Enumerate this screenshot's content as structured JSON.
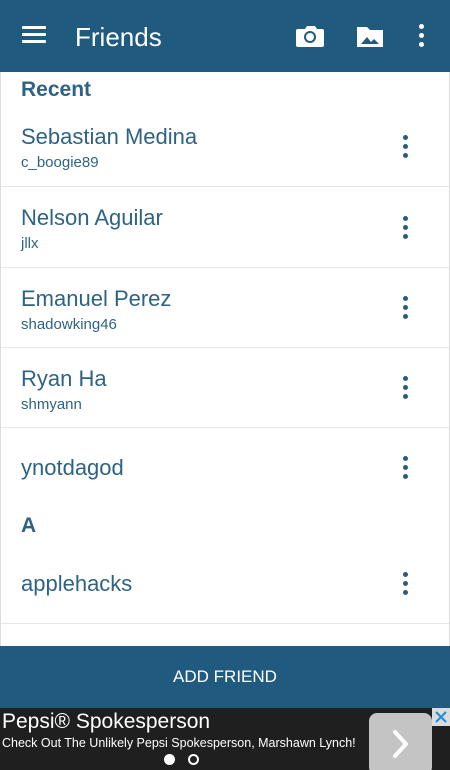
{
  "appbar": {
    "title": "Friends",
    "color": "#215a7f"
  },
  "sections": [
    {
      "header": "Recent"
    },
    {
      "header": "A"
    }
  ],
  "friends": [
    {
      "name": "Sebastian Medina",
      "username": "c_boogie89"
    },
    {
      "name": "Nelson Aguilar",
      "username": "jllx"
    },
    {
      "name": "Emanuel Perez",
      "username": "shadowking46"
    },
    {
      "name": "Ryan Ha",
      "username": "shmyann"
    },
    {
      "name": "ynotdagod",
      "username": ""
    },
    {
      "name": "applehacks",
      "username": ""
    }
  ],
  "footer": {
    "add_friend_label": "ADD FRIEND"
  },
  "ad": {
    "headline": "Pepsi® Spokesperson",
    "subtext": "Check Out The Unlikely Pepsi Spokesperson, Marshawn Lynch!",
    "pages": 2,
    "active_page": 1
  },
  "icons": [
    "menu-icon",
    "camera-icon",
    "image-folder-icon",
    "more-vert-icon",
    "chevron-right-icon",
    "close-icon"
  ]
}
